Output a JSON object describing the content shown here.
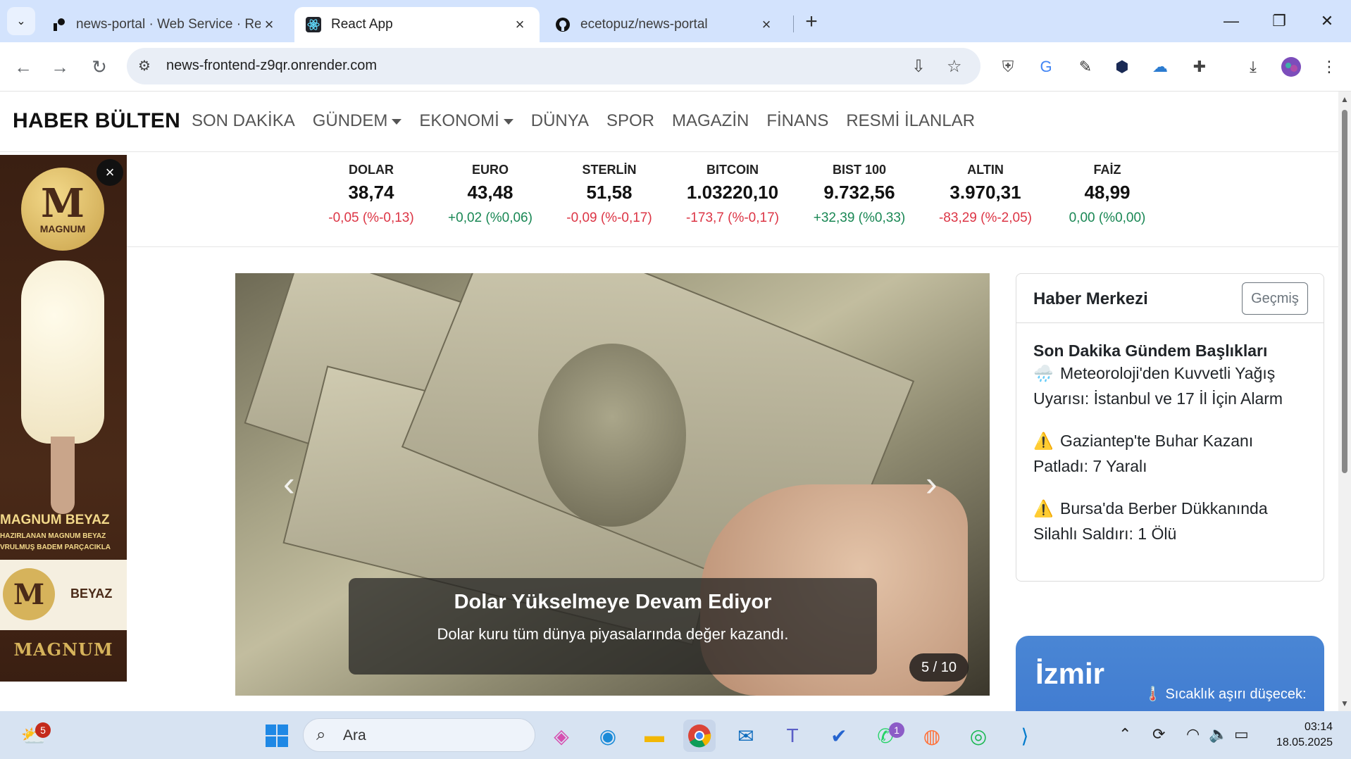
{
  "browser": {
    "tabs": [
      {
        "label": "news-portal · Web Service · Re",
        "icon": "render-icon",
        "active": false
      },
      {
        "label": "React App",
        "icon": "react-icon",
        "active": true
      },
      {
        "label": "ecetopuz/news-portal",
        "icon": "github-icon",
        "active": false
      }
    ],
    "url": "news-frontend-z9qr.onrender.com"
  },
  "site": {
    "brand": "HABER BÜLTEN",
    "nav": {
      "son_dakika": "SON DAKİKA",
      "gundem": "GÜNDEM",
      "ekonomi": "EKONOMİ",
      "dunya": "DÜNYA",
      "spor": "SPOR",
      "magazin": "MAGAZİN",
      "finans": "FİNANS",
      "resmi": "RESMİ İLANLAR"
    },
    "ticker": [
      {
        "name": "DOLAR",
        "value": "38,74",
        "change": "-0,05 (%-0,13)",
        "dir": "neg"
      },
      {
        "name": "EURO",
        "value": "43,48",
        "change": "+0,02 (%0,06)",
        "dir": "pos"
      },
      {
        "name": "STERLİN",
        "value": "51,58",
        "change": "-0,09 (%-0,17)",
        "dir": "neg"
      },
      {
        "name": "BITCOIN",
        "value": "1.03220,10",
        "change": "-173,7 (%-0,17)",
        "dir": "neg"
      },
      {
        "name": "BIST 100",
        "value": "9.732,56",
        "change": "+32,39 (%0,33)",
        "dir": "pos"
      },
      {
        "name": "ALTIN",
        "value": "3.970,31",
        "change": "-83,29 (%-2,05)",
        "dir": "neg"
      },
      {
        "name": "FAİZ",
        "value": "48,99",
        "change": "0,00 (%0,00)",
        "dir": "pos"
      }
    ],
    "ad": {
      "logo_letter": "M",
      "logo_text": "MAGNUM",
      "headline": "MAGNUM BEYAZ",
      "sub1": "HAZIRLANAN MAGNUM BEYAZ",
      "sub2": "VRULMUŞ BADEM PARÇACIKLA",
      "pack_label": "BEYAZ",
      "brand": "MAGNUM",
      "close": "×"
    },
    "carousel": {
      "title": "Dolar Yükselmeye Devam Ediyor",
      "subtitle": "Dolar kuru tüm dünya piyasalarında değer kazandı.",
      "counter": "5 / 10"
    },
    "haber_merkezi": {
      "title": "Haber Merkezi",
      "button": "Geçmiş",
      "section": "Son Dakika Gündem Başlıkları",
      "items": [
        {
          "icon": "🌧️",
          "text": "Meteoroloji'den Kuvvetli Yağış Uyarısı: İstanbul ve 17 İl İçin Alarm"
        },
        {
          "icon": "⚠️",
          "text": "Gaziantep'te Buhar Kazanı Patladı: 7 Yaralı"
        },
        {
          "icon": "⚠️",
          "text": "Bursa'da Berber Dükkanında Silahlı Saldırı: 1 Ölü"
        }
      ]
    },
    "weather": {
      "city": "İzmir",
      "message": "🌡️ Sıcaklık aşırı düşecek:"
    }
  },
  "taskbar": {
    "search_placeholder": "Ara",
    "weather_badge": "5",
    "whatsapp_badge": "1",
    "time": "03:14",
    "date": "18.05.2025"
  }
}
